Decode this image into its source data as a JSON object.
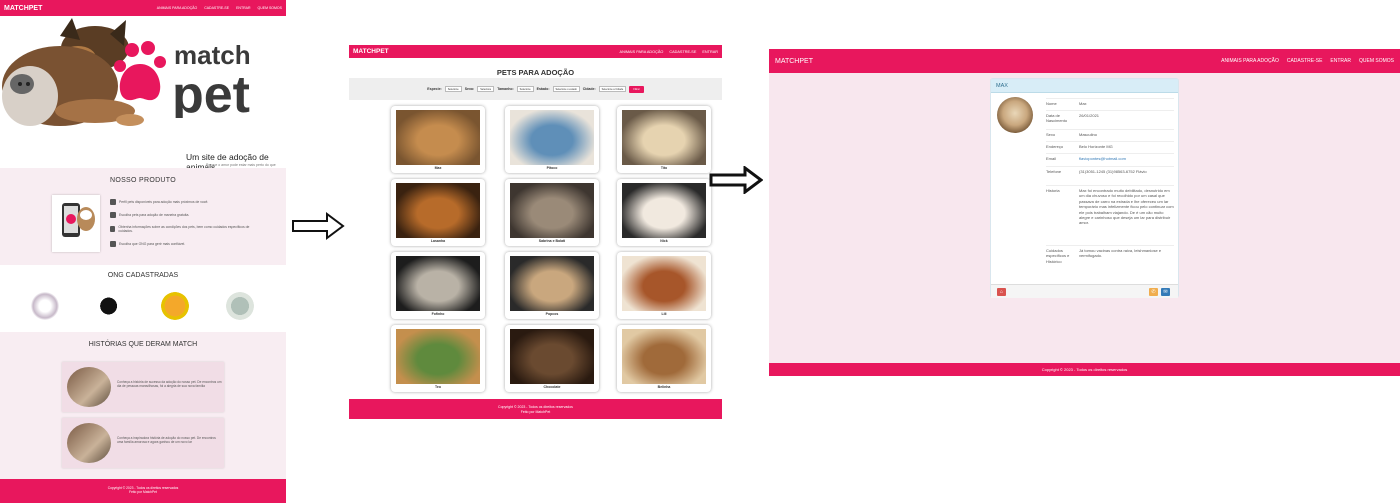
{
  "colors": {
    "brand": "#e8175d",
    "panel_bg": "#f8e7ee",
    "section_bg": "#f8edf2"
  },
  "home": {
    "brand": "MATCHPET",
    "nav": [
      "ANIMAIS PARA ADOÇÃO",
      "CADASTRE-SE",
      "ENTRAR",
      "QUEM SOMOS"
    ],
    "logo_top": "match",
    "logo_bottom": "pet",
    "tagline": "Um site de adoção de animais",
    "tagline_sub": "Porque o amor pode estar mais perto do que imagina",
    "product_title": "NOSSO PRODUTO",
    "features": [
      "Perfil pets disponíveis para adoção mais próximos de você.",
      "Escolha pets para adoção de maneira gratuita.",
      "Obtenha informações sobre as condições dos pets, bem como cuidados especificos de cuidados.",
      "Escolha que ONG para gerir mais confiável."
    ],
    "ong_title": "ONG CADASTRADAS",
    "stories_title": "HISTÓRIAS QUE DERAM MATCH",
    "stories": [
      "Conheça a história de sucesso da adoção do nosso pet. De encontros um dia de pessoas maravilhosas, foi a alegria de sua nova família",
      "Conheça a inspiradora história de adoção do nosso pet. De encontros uma família amorosa e agora ganhou de um novo lar"
    ],
    "footer": [
      "Copyright © 2023 - Todos os direitos reservados",
      "Feito por MatchPet"
    ]
  },
  "listing": {
    "brand": "MATCHPET",
    "nav": [
      "ANIMAIS PARA ADOÇÃO",
      "CADASTRE-SE",
      "ENTRAR"
    ],
    "title": "PETS PARA ADOÇÃO",
    "filters": [
      {
        "label": "Especie:",
        "value": "Selecione"
      },
      {
        "label": "Sexo:",
        "value": "Selecione"
      },
      {
        "label": "Tamanho:",
        "value": "Selecione"
      },
      {
        "label": "Estado:",
        "value": "Selecione o estado"
      },
      {
        "label": "Cidade:",
        "value": "Selecione a Cidade"
      }
    ],
    "filter_button": "Filtrar",
    "pets": [
      "Max",
      "Pitoco",
      "Tito",
      "Lasanha",
      "Sabrina e Bolati",
      "Nick",
      "Fofinho",
      "Popcos",
      "Lili",
      "Teo",
      "Chocolate",
      "Belinha"
    ],
    "footer": [
      "Copyright © 2023 - Todos os direitos reservados",
      "Feito por MatchPet"
    ]
  },
  "detail": {
    "brand": "MATCHPET",
    "nav": [
      "ANIMAIS PARA ADOÇÃO",
      "CADASTRE-SE",
      "ENTRAR",
      "QUEM SOMOS"
    ],
    "panel_title": "MAX",
    "fields": [
      {
        "k": "Nome",
        "v": "Max"
      },
      {
        "k": "Data de Nascimento",
        "v": "26/01/2021"
      },
      {
        "k": "Sexo",
        "v": "Masculino"
      },
      {
        "k": "Endereço",
        "v": "Belo Horizonte MG"
      },
      {
        "k": "Email",
        "v": "flaviopontes@hotmail.com"
      },
      {
        "k": "Telefone",
        "v": "(31)3051-1245 (31)98563-6752 Flávio"
      },
      {
        "k": "Historia",
        "v": "Max foi encontrado muito debilitado, desnutrido em um dia chuvoso e foi recolhido por um casal que passava de carro na estrada e lhe ofereceu um lar temporário mas infelizmente ficou pelo continuar com ele pois trabalham viajando. De é um cão muito alegre e carinhoso que deseja um lar para distribuir amor."
      },
      {
        "k": "Cuidados específicos e Histórico",
        "v": "Já tomou vacinas contra raiva, leishmaniose e vermifugado."
      }
    ],
    "footer": "Copyright © 2023 - Todos os direitos reservados"
  }
}
